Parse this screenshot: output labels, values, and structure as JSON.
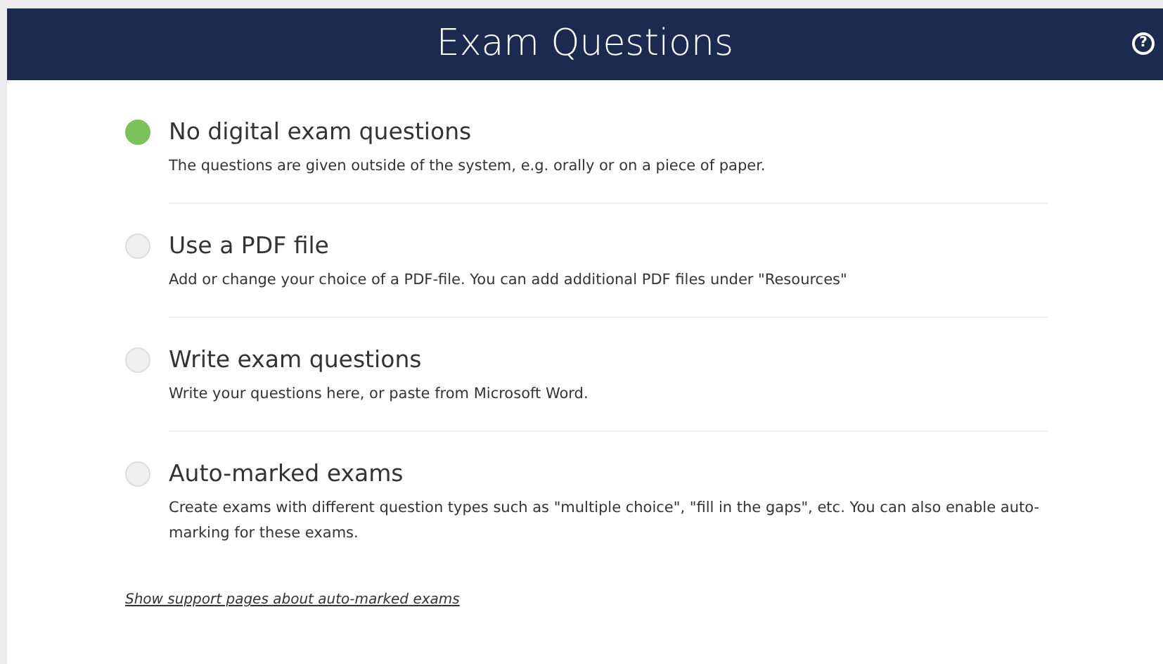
{
  "header": {
    "title": "Exam Questions",
    "help_icon": "?"
  },
  "options": [
    {
      "title": "No digital exam questions",
      "description": "The questions are given outside of the system, e.g. orally or on a piece of paper.",
      "selected": true
    },
    {
      "title": "Use a PDF file",
      "description": "Add or change your choice of a PDF-file. You can add additional PDF files under \"Resources\"",
      "selected": false
    },
    {
      "title": "Write exam questions",
      "description": "Write your questions here, or paste from Microsoft Word.",
      "selected": false
    },
    {
      "title": "Auto-marked exams",
      "description": "Create exams with different question types such as \"multiple choice\", \"fill in the gaps\", etc. You can also enable auto-marking for these exams.",
      "selected": false
    }
  ],
  "support_link": "Show support pages about auto-marked exams"
}
